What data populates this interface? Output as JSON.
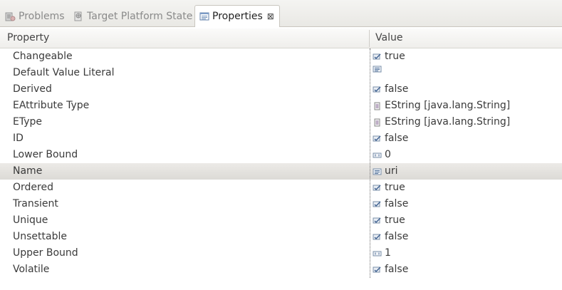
{
  "tabs": [
    {
      "label": "Problems",
      "icon": "problems-icon",
      "active": false
    },
    {
      "label": "Target Platform State",
      "icon": "target-platform-icon",
      "active": false
    },
    {
      "label": "Properties",
      "icon": "properties-icon",
      "active": true,
      "close_symbol": "⊠"
    }
  ],
  "table": {
    "headers": {
      "property": "Property",
      "value": "Value"
    },
    "rows": [
      {
        "property": "Changeable",
        "value": "true",
        "value_icon": "boolean-icon"
      },
      {
        "property": "Default Value Literal",
        "value": "",
        "value_icon": "text-value-icon"
      },
      {
        "property": "Derived",
        "value": "false",
        "value_icon": "boolean-icon"
      },
      {
        "property": "EAttribute Type",
        "value": "EString [java.lang.String]",
        "value_icon": "datatype-icon"
      },
      {
        "property": "EType",
        "value": "EString [java.lang.String]",
        "value_icon": "datatype-icon"
      },
      {
        "property": "ID",
        "value": "false",
        "value_icon": "boolean-icon"
      },
      {
        "property": "Lower Bound",
        "value": "0",
        "value_icon": "integer-icon"
      },
      {
        "property": "Name",
        "value": "uri",
        "value_icon": "text-value-icon",
        "selected": true
      },
      {
        "property": "Ordered",
        "value": "true",
        "value_icon": "boolean-icon"
      },
      {
        "property": "Transient",
        "value": "false",
        "value_icon": "boolean-icon"
      },
      {
        "property": "Unique",
        "value": "true",
        "value_icon": "boolean-icon"
      },
      {
        "property": "Unsettable",
        "value": "false",
        "value_icon": "boolean-icon"
      },
      {
        "property": "Upper Bound",
        "value": "1",
        "value_icon": "integer-icon"
      },
      {
        "property": "Volatile",
        "value": "false",
        "value_icon": "boolean-icon"
      }
    ]
  }
}
